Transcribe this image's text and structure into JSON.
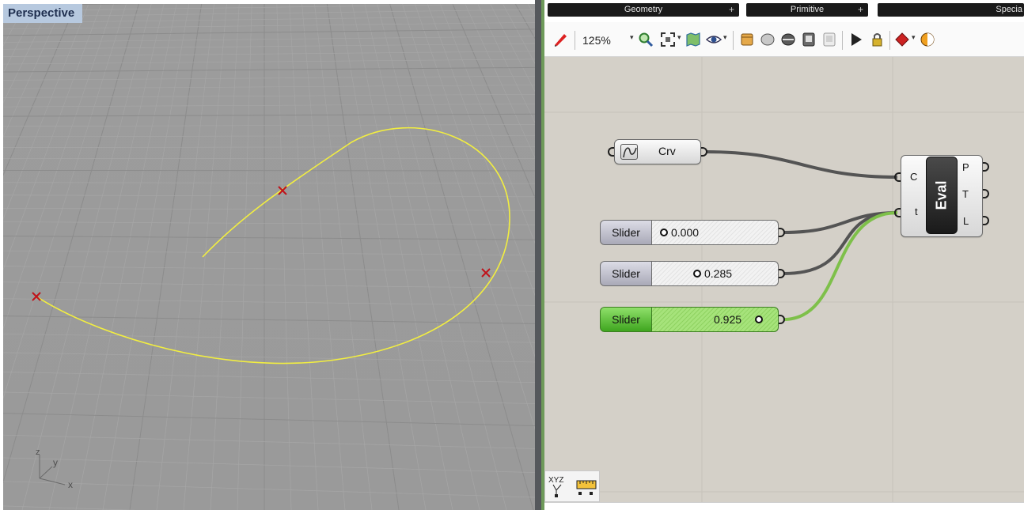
{
  "rhino": {
    "viewport_title": "Perspective",
    "axis_labels": {
      "z": "z",
      "y": "y",
      "x": "x"
    }
  },
  "grasshopper": {
    "tabs": [
      {
        "label": "Geometry"
      },
      {
        "label": "Primitive"
      },
      {
        "label": "Specia"
      }
    ],
    "toolbar": {
      "zoom": "125%"
    },
    "components": {
      "curve_param": {
        "label": "Crv"
      },
      "sliders": [
        {
          "name": "Slider",
          "value": "0.000",
          "t": 0.0
        },
        {
          "name": "Slider",
          "value": "0.285",
          "t": 0.285
        },
        {
          "name": "Slider",
          "value": "0.925",
          "t": 0.925
        }
      ],
      "evaluate": {
        "label": "Eval",
        "inputs": [
          "C",
          "t"
        ],
        "outputs": [
          "P",
          "T",
          "L"
        ]
      }
    },
    "colors": {
      "curve": "#f2ee40",
      "active_wire": "#7ec04a",
      "wire": "#545454",
      "active_slider": "#5cc032"
    }
  }
}
